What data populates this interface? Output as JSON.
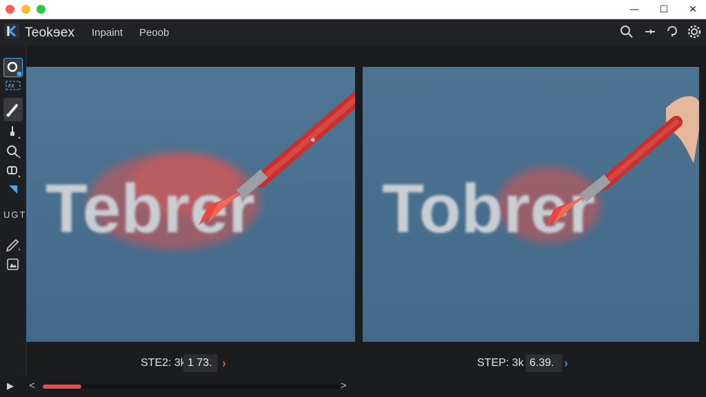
{
  "window": {
    "close_color": "#ff5f57",
    "minimize_color": "#febc2e",
    "zoom_color": "#28c840",
    "controls": {
      "minimize": "—",
      "maximize": "☐",
      "close": "✕"
    }
  },
  "header": {
    "title": "Teokɘex",
    "mode": "Inpaint",
    "document": "Peoob",
    "icons": [
      "search-icon",
      "pin-icon",
      "help-icon",
      "settings-icon"
    ]
  },
  "toolbar": {
    "tools": [
      "circle-select-icon",
      "frame-icon",
      "brush-icon",
      "smudge-icon",
      "zoom-icon",
      "mask-icon",
      "triangle-icon",
      "text-icon",
      "pen-icon",
      "image-icon"
    ],
    "text_tool_label": "UGT"
  },
  "canvas": {
    "left_word": "Tebrer",
    "right_word": "Tobrer",
    "background_color": "#4b7190",
    "paint_color": "#d9534f",
    "letter_color": "#c9ced3"
  },
  "left_step": {
    "label": "STE2: 3k",
    "value": "1 73.",
    "arrow": "›",
    "arrow_color": "#e0504a"
  },
  "right_step": {
    "label": "STEP: 3k",
    "value": "6.39.",
    "arrow": "›",
    "arrow_color": "#2d9be0"
  },
  "timeline": {
    "play": "▶",
    "prev": "<",
    "next": ">",
    "progress": 0.13,
    "fill_color": "#d9534f"
  }
}
